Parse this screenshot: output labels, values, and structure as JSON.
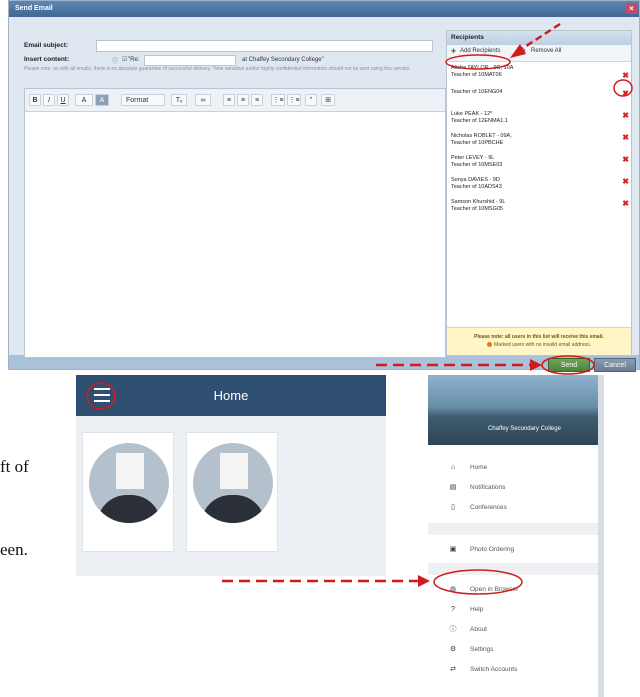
{
  "email_window": {
    "title": "Send Email",
    "close_icon": "close-icon",
    "subject_label": "Email subject:",
    "insert_label": "Insert content:",
    "insert_prefix": "\"Re:",
    "insert_suffix": "at Chaffey Secondary College\"",
    "note": "Please note: as with all emails, there is no absolute guarantee of successful delivery. Time sensitive and/or highly confidential information should not be sent using this service.",
    "toolbar": [
      "B",
      "I",
      "U",
      "A",
      "A",
      "Format",
      "Tₓ",
      "∞",
      "≡",
      "≡",
      "≡",
      "⋮≡",
      "⋮≡",
      "\"",
      "⊞"
    ],
    "recipients": {
      "header": "Recipients",
      "add_label": "Add Recipients",
      "remove_label": "Remove All",
      "items": [
        {
          "name": "Alisha TAYLOR - 9C, 10A",
          "sub": "Teacher of 10MAT06"
        },
        {
          "name": "",
          "sub": "Teacher of 10ENG04"
        },
        {
          "name": "Luke PEAK - 12*",
          "sub": "Teacher of 12ENMA1.1"
        },
        {
          "name": "Nicholas ROBLET - 09A,",
          "sub": "Teacher of 10PBCHE"
        },
        {
          "name": "Peter LEVEY - 9L",
          "sub": "Teacher of 10MSE03"
        },
        {
          "name": "Sonya DAVIES - 9D",
          "sub": "Teacher of 10ADS43"
        },
        {
          "name": "Samson Khurshid - 9L",
          "sub": "Teacher of 10MSG05"
        }
      ],
      "warning_line1": "Please note: all users in this list will receive this email.",
      "warning_line2": "Marked users with no invalid email address."
    },
    "send_label": "Send",
    "cancel_label": "Cancel"
  },
  "phone": {
    "title": "Home",
    "menu_icon": "hamburger-icon"
  },
  "drawer": {
    "school": "Chaffey Secondary College",
    "items": [
      {
        "icon": "🏠",
        "label": "Home"
      },
      {
        "icon": "▤",
        "label": "Notifications"
      },
      {
        "icon": "▯",
        "label": "Conferences"
      },
      {
        "icon": "▣",
        "label": "Photo Ordering"
      },
      {
        "icon": "◍",
        "label": "Open in Browser"
      },
      {
        "icon": "?",
        "label": "Help"
      },
      {
        "icon": "ⓘ",
        "label": "About"
      },
      {
        "icon": "⚙",
        "label": "Settings"
      },
      {
        "icon": "⇄",
        "label": "Switch Accounts"
      }
    ]
  },
  "doc_fragments": {
    "line1": "ft of",
    "line2": "een."
  }
}
